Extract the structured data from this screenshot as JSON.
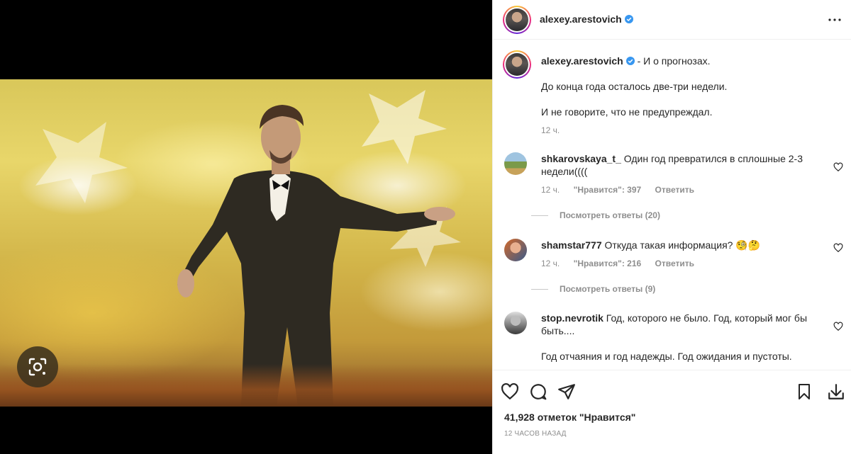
{
  "post": {
    "author": "alexey.arestovich",
    "verified": true,
    "caption_sep": " - ",
    "caption_lines": [
      "И о прогнозах.",
      "До конца года осталось две-три недели.",
      "И не говорите, что не предупреждал."
    ],
    "caption_time": "12 ч."
  },
  "comments": [
    {
      "user": "shkarovskaya_t_",
      "text": "Один год превратился в сплошные 2-3 недели((((",
      "time": "12 ч.",
      "likes_label": "\"Нравится\": 397",
      "reply_label": "Ответить",
      "view_replies": "Посмотреть ответы (20)"
    },
    {
      "user": "shamstar777",
      "text": "Откуда такая информация? 🧐🤔",
      "time": "12 ч.",
      "likes_label": "\"Нравится\": 216",
      "reply_label": "Ответить",
      "view_replies": "Посмотреть ответы (9)"
    },
    {
      "user": "stop.nevrotik",
      "text": "Год, которого не было. Год, который мог бы быть....",
      "text2": "Год отчаяния и год надежды. Год ожидания и пустоты."
    }
  ],
  "footer": {
    "likes": "41,928 отметок \"Нравится\"",
    "time": "12 часов назад"
  },
  "icons": {
    "lens": "lens-search-icon",
    "more": "more-horizontal-icon",
    "verified": "verified-badge-icon",
    "like": "heart-icon",
    "comment": "comment-icon",
    "share": "share-icon",
    "save": "bookmark-icon",
    "download": "download-icon"
  },
  "colors": {
    "verified": "#3897f0",
    "text": "#262626",
    "muted": "#8e8e8e"
  }
}
